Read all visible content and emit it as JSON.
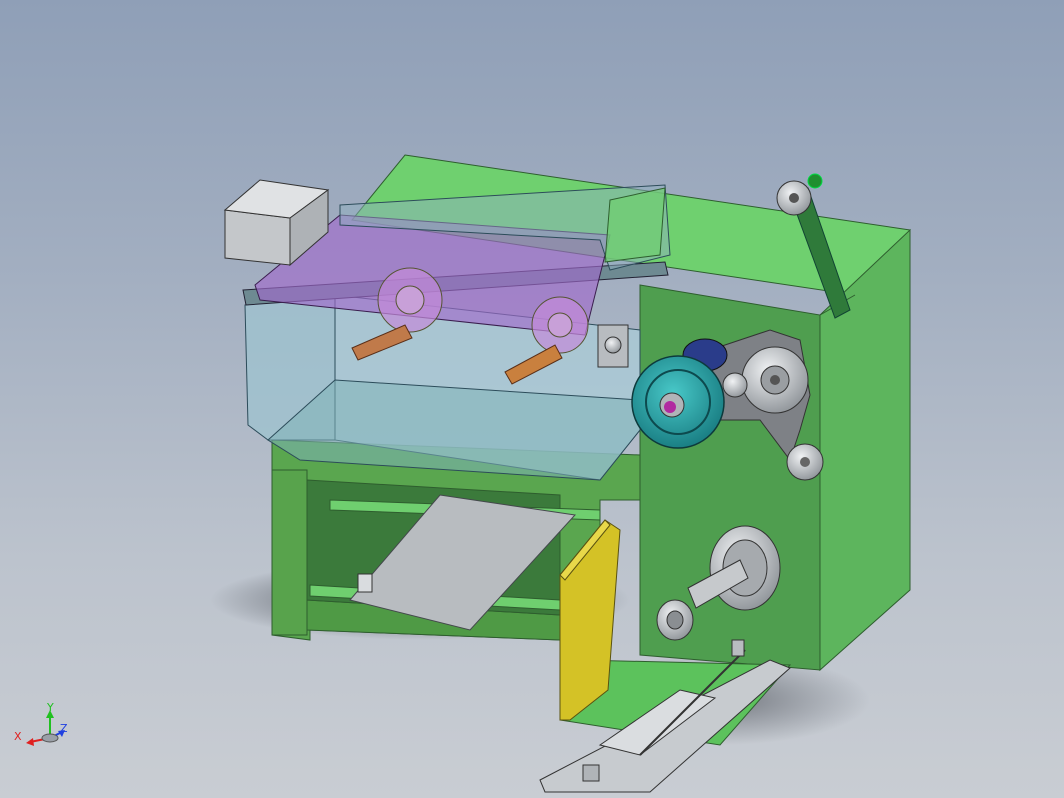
{
  "viewport": {
    "type": "cad-3d-viewport"
  },
  "triad": {
    "x_label": "X",
    "y_label": "Y",
    "z_label": "Z",
    "x_color": "#e02020",
    "y_color": "#20c020",
    "z_color": "#2040e0"
  },
  "colors": {
    "frame_green": "#5ec25e",
    "frame_dark_green": "#3f8f3f",
    "cabinet_green": "#4fa64f",
    "hopper_glass": "#a8c8d4",
    "purple_lid": "#b06ad0",
    "teal_pulley": "#2aa5a8",
    "yellow_guard": "#d4c226",
    "steel": "#c8ccd0",
    "copper_roller": "#c07a4a"
  }
}
